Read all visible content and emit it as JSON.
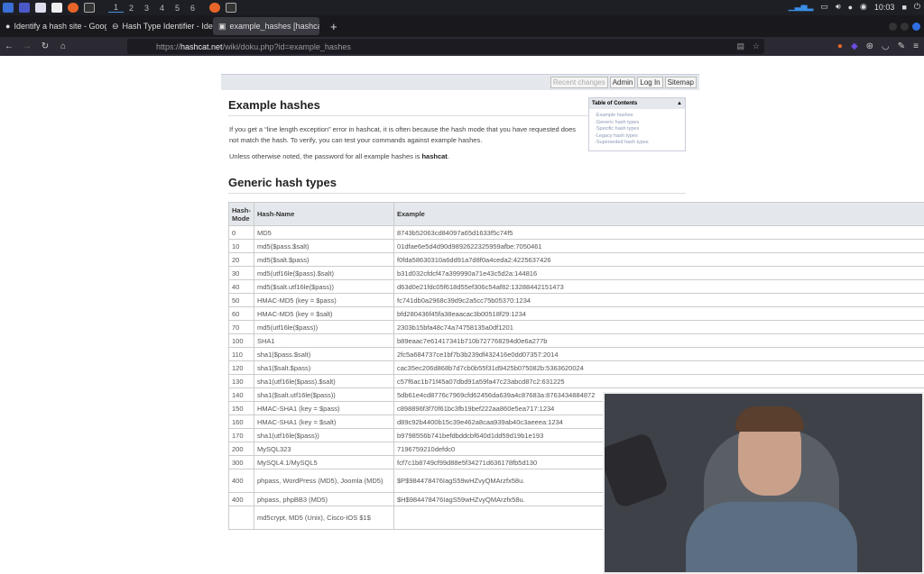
{
  "taskbar": {
    "workspaces": [
      "1",
      "2",
      "3",
      "4",
      "5",
      "6"
    ],
    "clock": "10:03"
  },
  "tabs": [
    {
      "label": "Identify a hash site - Goog"
    },
    {
      "label": "Hash Type Identifier - Ide"
    },
    {
      "label": "example_hashes [hashcat"
    }
  ],
  "url": {
    "prefix": "https://",
    "domain": "hashcat.net",
    "path": "/wiki/doku.php?id=example_hashes"
  },
  "wiki": {
    "buttons": [
      "Recent changes",
      "Admin",
      "Log In",
      "Sitemap"
    ],
    "title": "Example hashes",
    "para1": "If you get a “line length exception” error in hashcat, it is often because the hash mode that you have requested does not match the hash. To verify, you can test your commands against example hashes.",
    "para2_pre": "Unless otherwise noted, the password for all example hashes is ",
    "para2_bold": "hashcat",
    "para2_post": ".",
    "toc_title": "Table of Contents",
    "toc": [
      "Example hashes",
      "Generic hash types",
      "Specific hash types",
      "Legacy hash types",
      "Superseded hash types"
    ],
    "section": "Generic hash types"
  },
  "table": {
    "headers": [
      "Hash-Mode",
      "Hash-Name",
      "Example"
    ],
    "rows": [
      [
        "0",
        "MD5",
        "8743b52063cd84097a65d1633f5c74f5"
      ],
      [
        "10",
        "md5($pass.$salt)",
        "01dfae6e5d4d90d9892622325959afbe:7050461"
      ],
      [
        "20",
        "md5($salt.$pass)",
        "f0fda58630310a6dd91a7d8f0a4ceda2:4225637426"
      ],
      [
        "30",
        "md5(utf16le($pass).$salt)",
        "b31d032cfdcf47a399990a71e43c5d2a:144816"
      ],
      [
        "40",
        "md5($salt.utf16le($pass))",
        "d63d0e21fdc05f618d55ef306c54af82:13288442151473"
      ],
      [
        "50",
        "HMAC-MD5 (key = $pass)",
        "fc741db0a2968c39d9c2a5cc75b05370:1234"
      ],
      [
        "60",
        "HMAC-MD5 (key = $salt)",
        "bfd280436f45fa38eaacac3b00518f29:1234"
      ],
      [
        "70",
        "md5(utf16le($pass))",
        "2303b15bfa48c74a74758135a0df1201"
      ],
      [
        "100",
        "SHA1",
        "b89eaac7e61417341b710b727768294d0e6a277b"
      ],
      [
        "110",
        "sha1($pass.$salt)",
        "2fc5a684737ce1bf7b3b239df432416e0dd07357:2014"
      ],
      [
        "120",
        "sha1($salt.$pass)",
        "cac35ec206d868b7d7cb0b55f31d9425b075082b:5363620024"
      ],
      [
        "130",
        "sha1(utf16le($pass).$salt)",
        "c57f6ac1b71f45a07dbd91a59fa47c23abcd87c2:631225"
      ],
      [
        "140",
        "sha1($salt.utf16le($pass))",
        "5db61e4cd8776c7969cfd62456da639a4c87683a:8763434884872"
      ],
      [
        "150",
        "HMAC-SHA1 (key = $pass)",
        "c898896f3f70f61bc3fb19bef222aa860e5ea717:1234"
      ],
      [
        "160",
        "HMAC-SHA1 (key = $salt)",
        "d89c92b4400b15c39e462a8caa939ab40c3aeeea:1234"
      ],
      [
        "170",
        "sha1(utf16le($pass))",
        "b9798556b741befdbddcbf640d1dd59d19b1e193"
      ],
      [
        "200",
        "MySQL323",
        "7196759210defdc0"
      ],
      [
        "300",
        "MySQL4.1/MySQL5",
        "fcf7c1b8749cf99d88e5f34271d636178fb5d130"
      ],
      [
        "400",
        "phpass, WordPress (MD5), Joomla (MD5)",
        "$P$984478476IagS59wHZvyQMArzfx58u."
      ],
      [
        "400",
        "phpass, phpBB3 (MD5)",
        "$H$984478476IagS59wHZvyQMArzfx58u."
      ],
      [
        "",
        "md5crypt, MD5 (Unix), Cisco-IOS $1$",
        ""
      ]
    ]
  }
}
